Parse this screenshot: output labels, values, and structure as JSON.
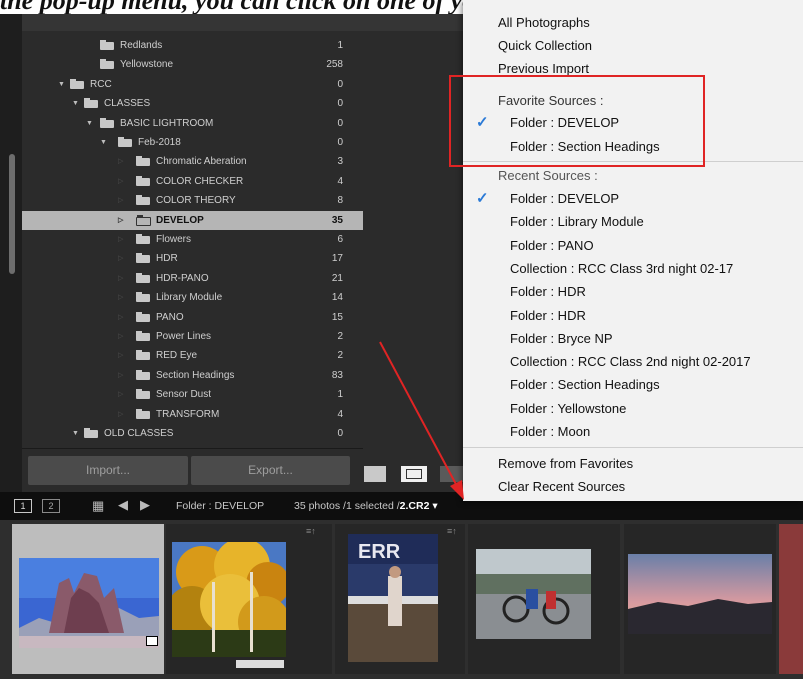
{
  "caption": "the pop-up menu, you can click on one of your Favorite folders.",
  "folder_tree": [
    {
      "label": "Redlands",
      "count": "1",
      "indent": 2,
      "tri": "",
      "faint": true
    },
    {
      "label": "Yellowstone",
      "count": "258",
      "indent": 2,
      "tri": "",
      "faint": true
    },
    {
      "label": "RCC",
      "count": "0",
      "indent": 0,
      "tri": "▼"
    },
    {
      "label": "CLASSES",
      "count": "0",
      "indent": 1,
      "tri": "▼"
    },
    {
      "label": "BASIC LIGHTROOM",
      "count": "0",
      "indent": 2,
      "tri": "▼"
    },
    {
      "label": "Feb-2018",
      "count": "0",
      "indent": 3,
      "tri": "▼"
    },
    {
      "label": "Chromatic Aberation",
      "count": "3",
      "indent": 4,
      "tri": "▷",
      "faint": true
    },
    {
      "label": "COLOR CHECKER",
      "count": "4",
      "indent": 4,
      "tri": "▷",
      "faint": true
    },
    {
      "label": "COLOR THEORY",
      "count": "8",
      "indent": 4,
      "tri": "▷",
      "faint": true
    },
    {
      "label": "DEVELOP",
      "count": "35",
      "indent": 4,
      "tri": "▷",
      "selected": true
    },
    {
      "label": "Flowers",
      "count": "6",
      "indent": 4,
      "tri": "▷",
      "faint": true
    },
    {
      "label": "HDR",
      "count": "17",
      "indent": 4,
      "tri": "▷",
      "faint": true
    },
    {
      "label": "HDR-PANO",
      "count": "21",
      "indent": 4,
      "tri": "▷",
      "faint": true
    },
    {
      "label": "Library Module",
      "count": "14",
      "indent": 4,
      "tri": "▷",
      "faint": true
    },
    {
      "label": "PANO",
      "count": "15",
      "indent": 4,
      "tri": "▷",
      "faint": true
    },
    {
      "label": "Power Lines",
      "count": "2",
      "indent": 4,
      "tri": "▷",
      "faint": true
    },
    {
      "label": "RED Eye",
      "count": "2",
      "indent": 4,
      "tri": "▷",
      "faint": true
    },
    {
      "label": "Section Headings",
      "count": "83",
      "indent": 4,
      "tri": "▷",
      "faint": true
    },
    {
      "label": "Sensor Dust",
      "count": "1",
      "indent": 4,
      "tri": "▷",
      "faint": true
    },
    {
      "label": "TRANSFORM",
      "count": "4",
      "indent": 4,
      "tri": "▷",
      "faint": true
    },
    {
      "label": "OLD CLASSES",
      "count": "0",
      "indent": 1,
      "tri": "▼"
    }
  ],
  "buttons": {
    "import": "Import...",
    "export": "Export..."
  },
  "filmbar": {
    "monitor_1": "1",
    "monitor_2": "2",
    "folder": "Folder : DEVELOP",
    "status_prefix": "35 photos /1 selected /",
    "filename": "2.CR2",
    "dropdown_glyph": "▾"
  },
  "menu": {
    "all_photographs": "All Photographs",
    "quick_collection": "Quick Collection",
    "previous_import": "Previous Import",
    "favorite_heading": "Favorite Sources :",
    "favorites": [
      {
        "label": "Folder : DEVELOP",
        "checked": true
      },
      {
        "label": "Folder : Section Headings",
        "checked": false
      }
    ],
    "recent_heading": "Recent Sources :",
    "recents": [
      {
        "label": "Folder : DEVELOP",
        "checked": true
      },
      {
        "label": "Folder : Library Module"
      },
      {
        "label": "Folder : PANO"
      },
      {
        "label": "Collection : RCC Class 3rd night 02-17"
      },
      {
        "label": "Folder : HDR"
      },
      {
        "label": "Folder : HDR"
      },
      {
        "label": "Folder : Bryce NP"
      },
      {
        "label": "Collection : RCC Class 2nd night 02-2017"
      },
      {
        "label": "Folder : Section Headings"
      },
      {
        "label": "Folder : Yellowstone"
      },
      {
        "label": "Folder : Moon"
      }
    ],
    "remove_favorites": "Remove from Favorites",
    "clear_recent": "Clear Recent Sources",
    "check_glyph": "✓"
  },
  "colors": {
    "panel_bg": "#2b2b2b",
    "selected_row": "#b5b5b5",
    "menu_bg": "#f2f2f2",
    "check": "#2b7ad6",
    "annotation_red": "#e02424"
  }
}
